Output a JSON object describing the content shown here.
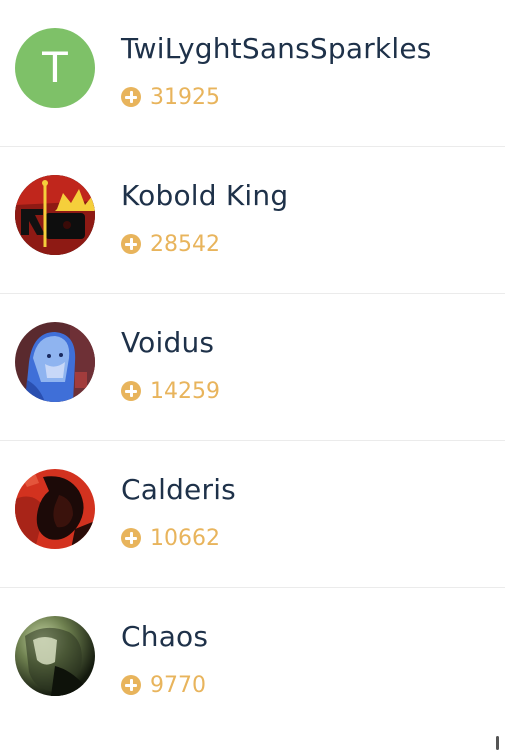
{
  "accent_color": "#e8b45c",
  "name_color": "#1e3149",
  "users": [
    {
      "name": "TwiLyghtSansSparkles",
      "points": "31925",
      "avatar_letter": "T",
      "avatar_color": "#7ec168"
    },
    {
      "name": "Kobold King",
      "points": "28542",
      "avatar_icon": "crown-icon"
    },
    {
      "name": "Voidus",
      "points": "14259"
    },
    {
      "name": "Calderis",
      "points": "10662"
    },
    {
      "name": "Chaos",
      "points": "9770"
    }
  ]
}
